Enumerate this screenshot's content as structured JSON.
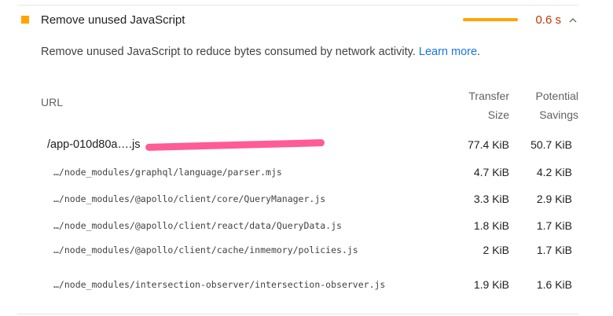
{
  "audit": {
    "title": "Remove unused JavaScript",
    "savings": "0.6 s",
    "status_color": "#ffa400",
    "savings_color": "#c33300",
    "expand_icon": "chevron-up-icon"
  },
  "description": {
    "text": "Remove unused JavaScript to reduce bytes consumed by network activity.",
    "link_text": "Learn more"
  },
  "table": {
    "headers": {
      "url": "URL",
      "transfer_line1": "Transfer",
      "transfer_line2": "Size",
      "savings_line1": "Potential",
      "savings_line2": "Savings"
    },
    "main_row": {
      "url": "/app-010d80a….js",
      "transfer": "77.4 KiB",
      "savings": "50.7 KiB"
    },
    "sub_rows": [
      {
        "url": "…/node_modules/graphql/language/parser.mjs",
        "transfer": "4.7 KiB",
        "savings": "4.2 KiB"
      },
      {
        "url": "…/node_modules/@apollo/client/core/QueryManager.js",
        "transfer": "3.3 KiB",
        "savings": "2.9 KiB"
      },
      {
        "url": "…/node_modules/@apollo/client/react/data/QueryData.js",
        "transfer": "1.8 KiB",
        "savings": "1.7 KiB"
      },
      {
        "url": "…/node_modules/@apollo/client/cache/inmemory/policies.js",
        "transfer": "2 KiB",
        "savings": "1.7 KiB"
      },
      {
        "url": "…/node_modules/intersection-observer/intersection-observer.js",
        "transfer": "1.9 KiB",
        "savings": "1.6 KiB"
      }
    ]
  }
}
